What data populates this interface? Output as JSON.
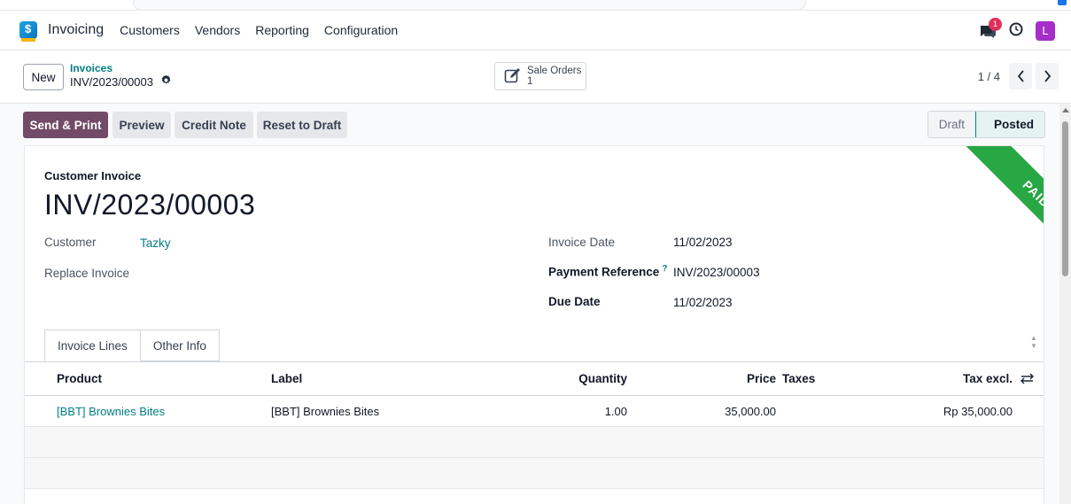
{
  "navbar": {
    "app_name": "Invoicing",
    "menu": [
      "Customers",
      "Vendors",
      "Reporting",
      "Configuration"
    ],
    "chat_badge": "1",
    "avatar_letter": "L"
  },
  "control": {
    "new_label": "New",
    "breadcrumb_parent": "Invoices",
    "breadcrumb_current": "INV/2023/00003",
    "smart_button_label": "Sale Orders",
    "smart_button_count": "1",
    "pager": "1 / 4"
  },
  "actions": {
    "send_print": "Send & Print",
    "preview": "Preview",
    "credit_note": "Credit Note",
    "reset_to_draft": "Reset to Draft"
  },
  "status": {
    "steps": [
      "Draft",
      "Posted"
    ],
    "current": "Posted"
  },
  "ribbon": "PAID",
  "form": {
    "type_label": "Customer Invoice",
    "name": "INV/2023/00003",
    "customer_label": "Customer",
    "customer_value": "Tazky",
    "replace_invoice_label": "Replace Invoice",
    "invoice_date_label": "Invoice Date",
    "invoice_date_value": "11/02/2023",
    "payment_reference_label": "Payment Reference",
    "payment_reference_help": "?",
    "payment_reference_value": "INV/2023/00003",
    "due_date_label": "Due Date",
    "due_date_value": "11/02/2023"
  },
  "tabs": [
    "Invoice Lines",
    "Other Info"
  ],
  "table": {
    "headers": {
      "product": "Product",
      "label": "Label",
      "quantity": "Quantity",
      "price": "Price",
      "taxes": "Taxes",
      "tax_excl": "Tax excl."
    },
    "rows": [
      {
        "product": "[BBT] Brownies Bites",
        "label": "[BBT] Brownies Bites",
        "quantity": "1.00",
        "price": "35,000.00",
        "taxes": "",
        "tax_excl": "Rp 35,000.00"
      }
    ]
  },
  "colors": {
    "primary": "#714b67",
    "link": "#017e84",
    "paid_ribbon": "#28a745",
    "badge": "#e0315a",
    "avatar": "#a42ec7"
  }
}
